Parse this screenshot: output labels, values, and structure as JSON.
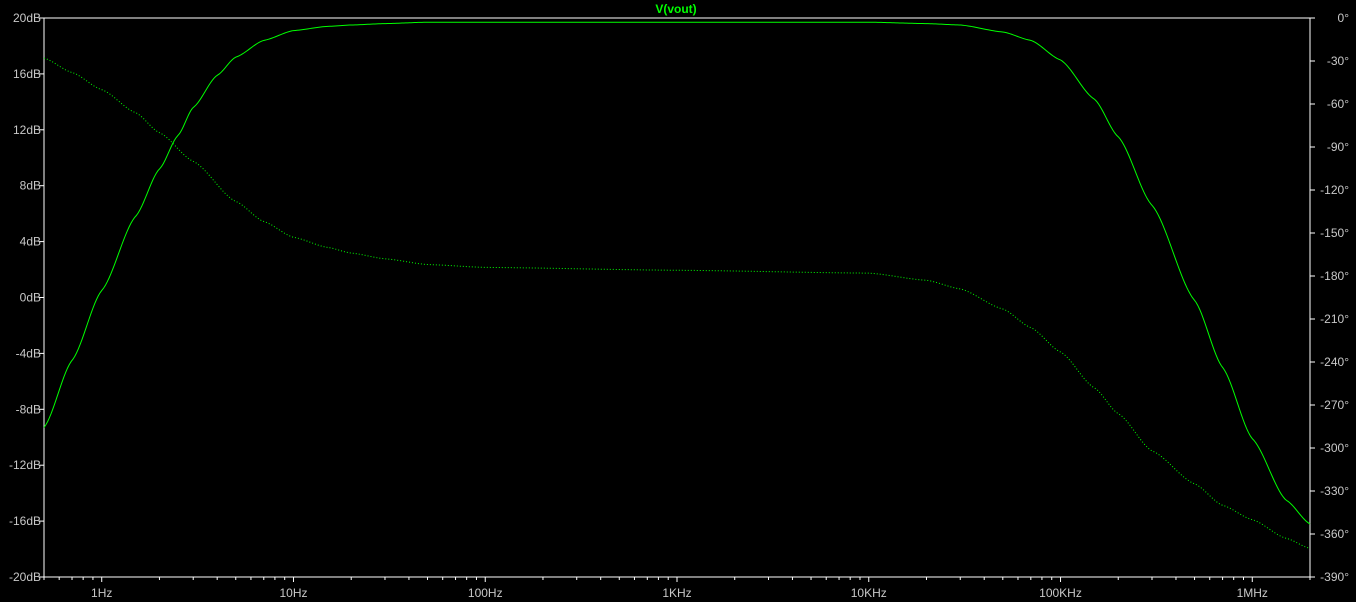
{
  "chart_data": {
    "type": "line",
    "title": "V(vout)",
    "xlabel": "",
    "ylabel": "",
    "x_scale": "log",
    "xlim": [
      0.5,
      2000000
    ],
    "ylim_left": [
      -20,
      20
    ],
    "ylim_right": [
      -390,
      0
    ],
    "grid": false,
    "x_ticks": [
      {
        "value": 1,
        "label": "1Hz"
      },
      {
        "value": 10,
        "label": "10Hz"
      },
      {
        "value": 100,
        "label": "100Hz"
      },
      {
        "value": 1000,
        "label": "1KHz"
      },
      {
        "value": 10000,
        "label": "10KHz"
      },
      {
        "value": 100000,
        "label": "100KHz"
      },
      {
        "value": 1000000,
        "label": "1MHz"
      }
    ],
    "y_ticks_left": [
      {
        "value": 20,
        "label": "20dB"
      },
      {
        "value": 16,
        "label": "16dB"
      },
      {
        "value": 12,
        "label": "12dB"
      },
      {
        "value": 8,
        "label": "8dB"
      },
      {
        "value": 4,
        "label": "4dB"
      },
      {
        "value": 0,
        "label": "0dB"
      },
      {
        "value": -4,
        "label": "-4dB"
      },
      {
        "value": -8,
        "label": "-8dB"
      },
      {
        "value": -12,
        "label": "-12dB"
      },
      {
        "value": -16,
        "label": "-16dB"
      },
      {
        "value": -20,
        "label": "-20dB"
      }
    ],
    "y_ticks_right": [
      {
        "value": 0,
        "label": "0°"
      },
      {
        "value": -30,
        "label": "-30°"
      },
      {
        "value": -60,
        "label": "-60°"
      },
      {
        "value": -90,
        "label": "-90°"
      },
      {
        "value": -120,
        "label": "-120°"
      },
      {
        "value": -150,
        "label": "-150°"
      },
      {
        "value": -180,
        "label": "-180°"
      },
      {
        "value": -210,
        "label": "-210°"
      },
      {
        "value": -240,
        "label": "-240°"
      },
      {
        "value": -270,
        "label": "-270°"
      },
      {
        "value": -300,
        "label": "-300°"
      },
      {
        "value": -330,
        "label": "-330°"
      },
      {
        "value": -360,
        "label": "-360°"
      },
      {
        "value": -390,
        "label": "-390°"
      }
    ],
    "series": [
      {
        "name": "V(vout)",
        "quantity": "magnitude",
        "axis": "left",
        "unit": "dB",
        "color": "#00ff00",
        "style": "solid",
        "x": [
          0.5,
          0.7,
          1,
          1.5,
          2,
          2.5,
          3,
          4,
          5,
          7,
          10,
          15,
          20,
          30,
          50,
          100,
          1000,
          10000,
          20000,
          30000,
          50000,
          70000,
          100000,
          150000,
          200000,
          300000,
          500000,
          700000,
          1000000,
          1500000,
          2000000
        ],
        "y": [
          -9.3,
          -4.5,
          0.5,
          5.8,
          9.2,
          11.6,
          13.6,
          15.9,
          17.2,
          18.4,
          19.1,
          19.4,
          19.5,
          19.6,
          19.7,
          19.7,
          19.7,
          19.7,
          19.6,
          19.5,
          19.0,
          18.4,
          17.0,
          14.2,
          11.5,
          6.6,
          -0.2,
          -5.0,
          -10.1,
          -14.5,
          -16.2
        ]
      },
      {
        "name": "V(vout)",
        "quantity": "phase",
        "axis": "right",
        "unit": "deg",
        "color": "#00ff00",
        "style": "dotted",
        "x": [
          0.5,
          0.7,
          1,
          1.5,
          2,
          3,
          5,
          7,
          10,
          15,
          20,
          30,
          50,
          100,
          1000,
          10000,
          20000,
          30000,
          50000,
          70000,
          100000,
          150000,
          200000,
          300000,
          500000,
          700000,
          1000000,
          1500000,
          2000000
        ],
        "y": [
          -28,
          -38,
          -50,
          -66,
          -80,
          -100,
          -128,
          -142,
          -153,
          -160,
          -164,
          -168,
          -172,
          -174,
          -176,
          -178,
          -183,
          -189,
          -203,
          -216,
          -233,
          -258,
          -276,
          -302,
          -325,
          -340,
          -350,
          -363,
          -370
        ]
      }
    ]
  }
}
